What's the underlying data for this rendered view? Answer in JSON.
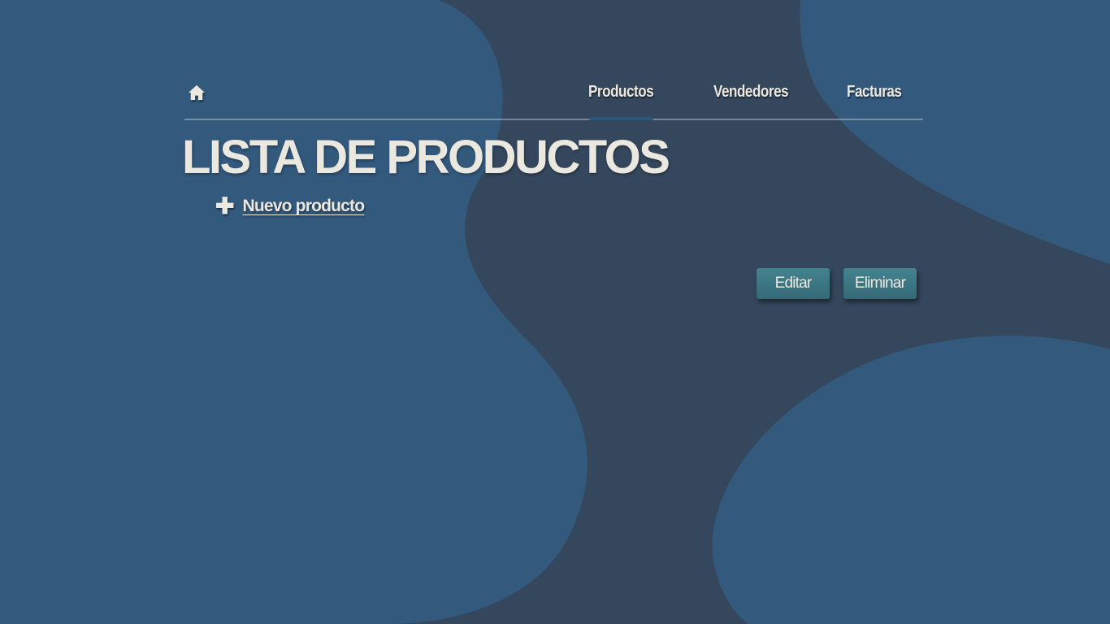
{
  "nav": {
    "home_icon": "home-icon",
    "links": [
      {
        "label": "Productos",
        "active": true
      },
      {
        "label": "Vendedores",
        "active": false
      },
      {
        "label": "Facturas",
        "active": false
      }
    ]
  },
  "page": {
    "title": "LISTA DE PRODUCTOS",
    "new_product_icon": "plus-icon",
    "new_product_label": "Nuevo producto"
  },
  "actions": {
    "edit_label": "Editar",
    "delete_label": "Eliminar"
  },
  "colors": {
    "background": "#34475d",
    "blob": "#33597d",
    "text": "#ebe8e0",
    "button": "#3f7c88"
  }
}
